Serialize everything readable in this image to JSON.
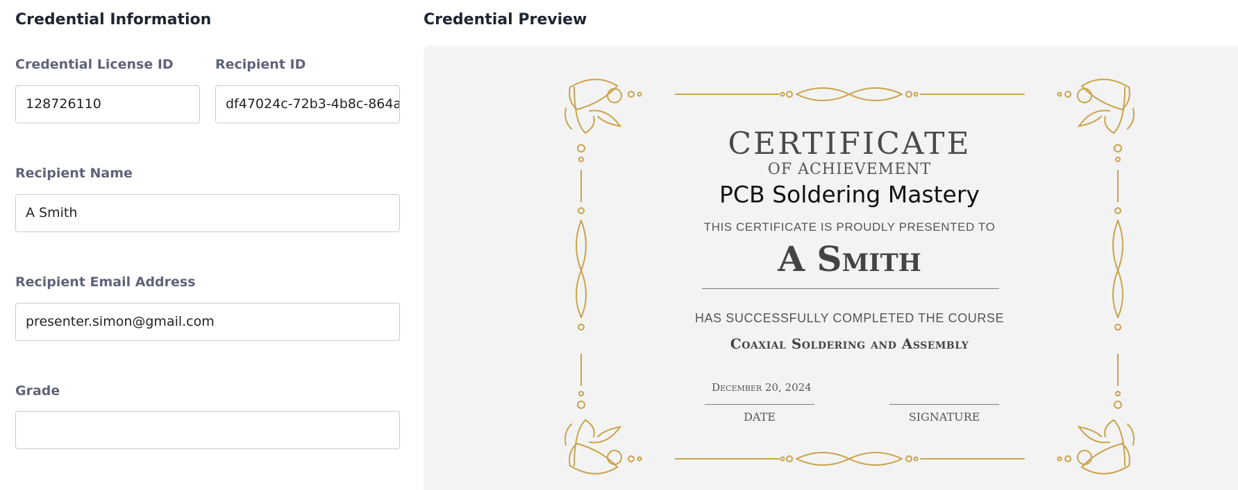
{
  "form": {
    "section_title": "Credential Information",
    "license_id_label": "Credential License ID",
    "license_id_value": "128726110",
    "recipient_id_label": "Recipient ID",
    "recipient_id_value": "df47024c-72b3-4b8c-864a",
    "name_label": "Recipient Name",
    "name_value": "A Smith",
    "email_label": "Recipient Email Address",
    "email_value": "presenter.simon@gmail.com",
    "grade_label": "Grade",
    "grade_value": ""
  },
  "preview": {
    "section_title": "Credential Preview",
    "certificate": {
      "title": "CERTIFICATE",
      "subtitle": "OF ACHIEVEMENT",
      "program": "PCB Soldering Mastery",
      "presented_text": "THIS CERTIFICATE IS PROUDLY PRESENTED TO",
      "recipient": "A Smith",
      "completed_text": "HAS SUCCESSFULLY COMPLETED THE COURSE",
      "course": "Coaxial Soldering and Assembly",
      "date": "December 20, 2024",
      "date_caption": "DATE",
      "signature_caption": "SIGNATURE"
    }
  },
  "colors": {
    "ornament_gold": "#c9a24a",
    "label_gray": "#5f6378",
    "panel_bg": "#f4f4f5"
  }
}
